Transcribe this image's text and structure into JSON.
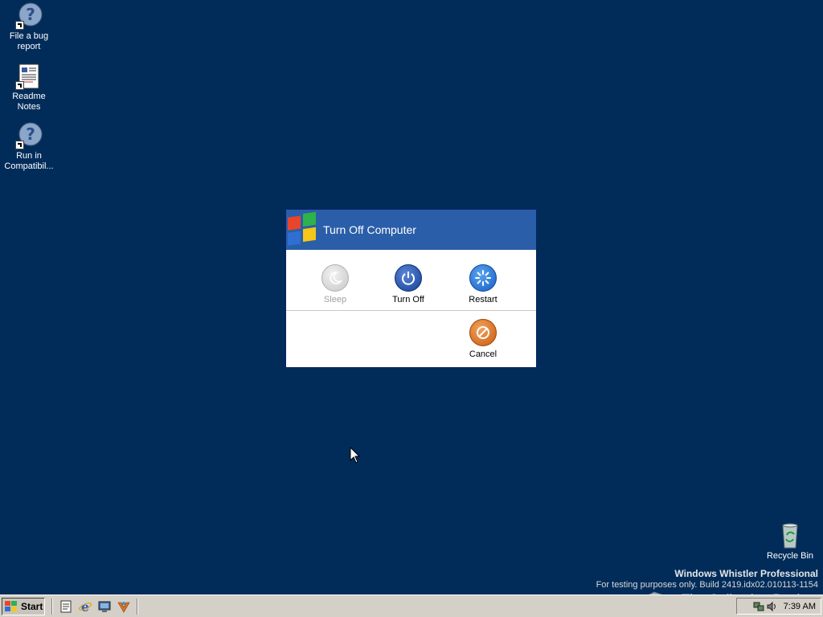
{
  "desktop": {
    "icons": [
      {
        "label_line1": "File a bug",
        "label_line2": "report"
      },
      {
        "label_line1": "Readme Notes",
        "label_line2": ""
      },
      {
        "label_line1": "Run in",
        "label_line2": "Compatibil..."
      }
    ],
    "recycle_bin": {
      "label": "Recycle Bin"
    }
  },
  "dialog": {
    "title": "Turn Off Computer",
    "options": {
      "sleep": {
        "label": "Sleep",
        "enabled": false
      },
      "turn_off": {
        "label": "Turn Off"
      },
      "restart": {
        "label": "Restart"
      },
      "cancel": {
        "label": "Cancel"
      }
    }
  },
  "watermark": {
    "title": "Windows Whistler Professional",
    "build": "For testing purposes only. Build 2419.idx02.010113-1154",
    "collection": "The Collection Book"
  },
  "taskbar": {
    "start_label": "Start",
    "clock": "7:39 AM",
    "quick_launch": [
      "notepad-icon",
      "internet-explorer-icon",
      "show-desktop-icon",
      "media-player-icon"
    ]
  },
  "colors": {
    "desktop": "#012c5a",
    "dialog_header": "#2a5ea8",
    "turn_off": "#1f4fa8",
    "restart": "#1e6fd4",
    "cancel": "#d8701e"
  }
}
